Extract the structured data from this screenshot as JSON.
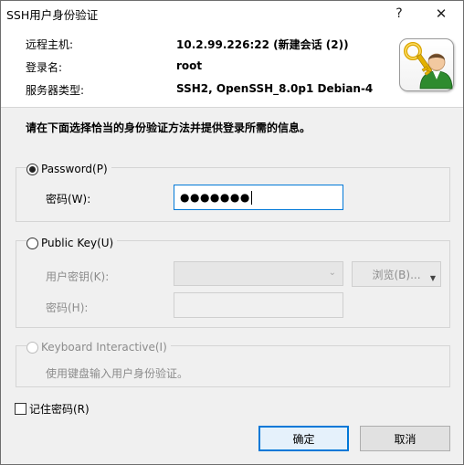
{
  "window": {
    "title": "SSH用户身份验证",
    "help_glyph": "?",
    "close_glyph": "✕"
  },
  "header": {
    "remote_host_label": "远程主机:",
    "remote_host_value": "10.2.99.226:22 (新建会话 (2))",
    "login_name_label": "登录名:",
    "login_name_value": "root",
    "server_type_label": "服务器类型:",
    "server_type_value": "SSH2, OpenSSH_8.0p1 Debian-4",
    "logo_icon": "user-key-icon"
  },
  "instruction": "请在下面选择恰当的身份验证方法并提供登录所需的信息。",
  "password_section": {
    "radio_label": "Password(P)",
    "selected": true,
    "password_label": "密码(W):",
    "password_value": "●●●●●●●"
  },
  "public_key_section": {
    "radio_label": "Public Key(U)",
    "selected": false,
    "user_key_label": "用户密钥(K):",
    "user_key_value": "",
    "browse_label": "浏览(B)...",
    "passphrase_label": "密码(H):",
    "passphrase_value": ""
  },
  "keyboard_section": {
    "radio_label": "Keyboard Interactive(I)",
    "selected": false,
    "description": "使用键盘输入用户身份验证。"
  },
  "remember_password": {
    "label": "记住密码(R)",
    "checked": false
  },
  "buttons": {
    "ok_label": "确定",
    "cancel_label": "取消"
  },
  "colors": {
    "focus_accent": "#0078d7",
    "dialog_background": "#f0f0f0",
    "disabled_text": "#8c8c8c"
  }
}
